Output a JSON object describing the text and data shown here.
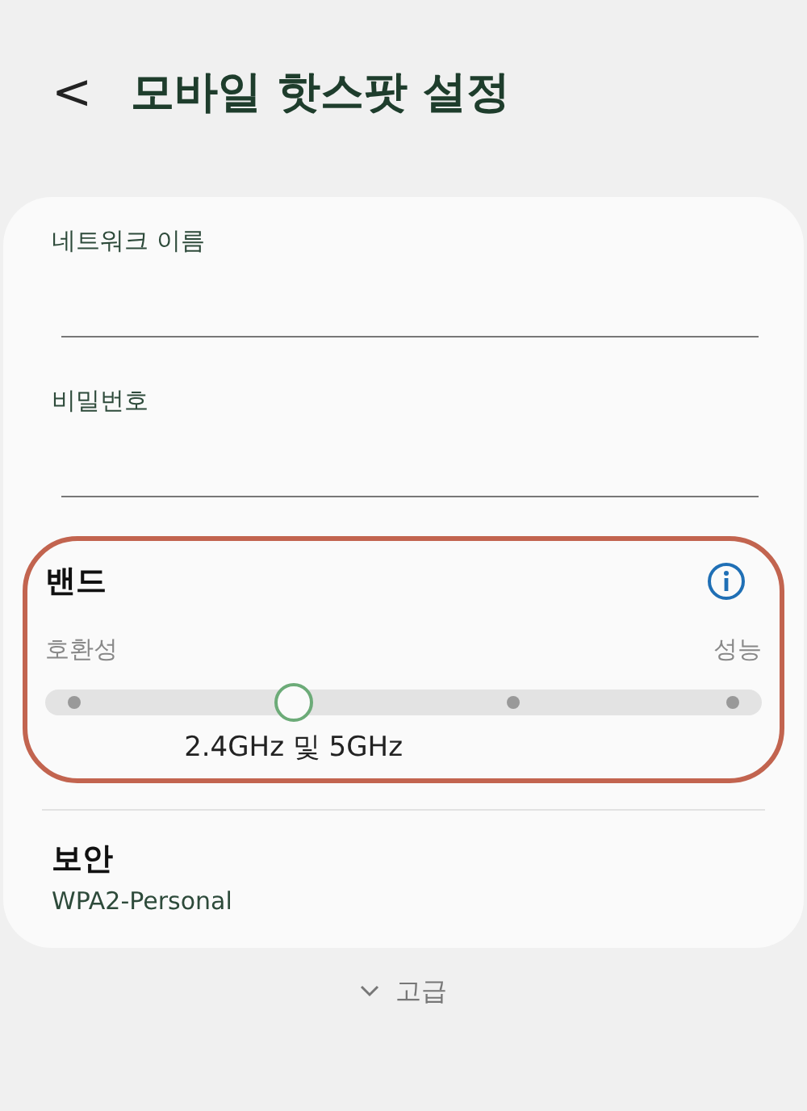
{
  "header": {
    "back": "<",
    "title": "모바일 핫스팟 설정"
  },
  "fields": [
    {
      "label": "네트워크 이름"
    },
    {
      "label": "비밀번호"
    }
  ],
  "band": {
    "title": "밴드",
    "highlighted": true,
    "min_label": "호환성",
    "max_label": "성능",
    "level": 0.333,
    "value": "2.4GHz 및 5GHz"
  },
  "security": {
    "title": "보안",
    "value": "WPA2-Personal"
  },
  "advanced": {
    "label": "고급",
    "expanded": false
  }
}
